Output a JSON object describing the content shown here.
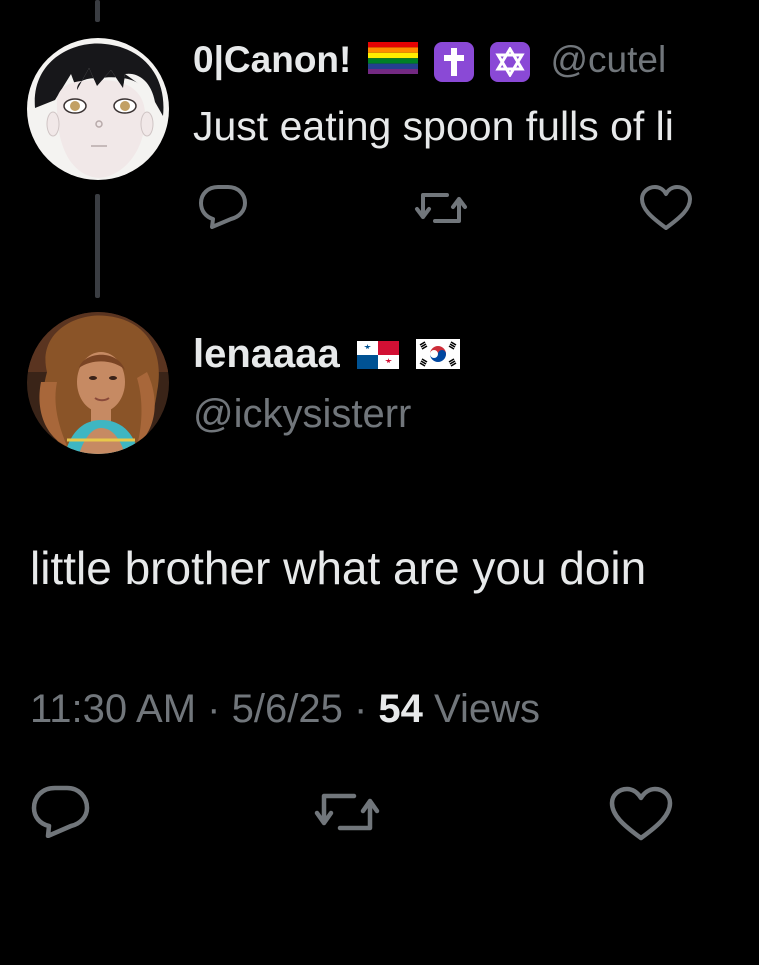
{
  "parent_tweet": {
    "display_name": "0|Canon!",
    "handle": "@cutel",
    "text": "Just eating spoon fulls of li",
    "badges": [
      "rainbow-flag-emoji",
      "latin-cross-emoji",
      "star-of-david-emoji"
    ],
    "actions": [
      "reply-icon",
      "retweet-icon",
      "like-icon"
    ]
  },
  "main_tweet": {
    "display_name": "lenaaaa",
    "flags": [
      "panama-flag-emoji",
      "south-korea-flag-emoji"
    ],
    "handle": "@ickysisterr",
    "text": "little brother what are you doin",
    "time": "11:30 AM",
    "date": "5/6/25",
    "views_count": "54",
    "views_label": "Views",
    "separator": "·",
    "actions": [
      "reply-icon",
      "retweet-icon",
      "like-icon"
    ]
  },
  "colors": {
    "background": "#000000",
    "primary_text": "#e7e9ea",
    "secondary_text": "#71767b",
    "thread_line": "#3a3d42",
    "badge_purple": "#8a49d6"
  }
}
